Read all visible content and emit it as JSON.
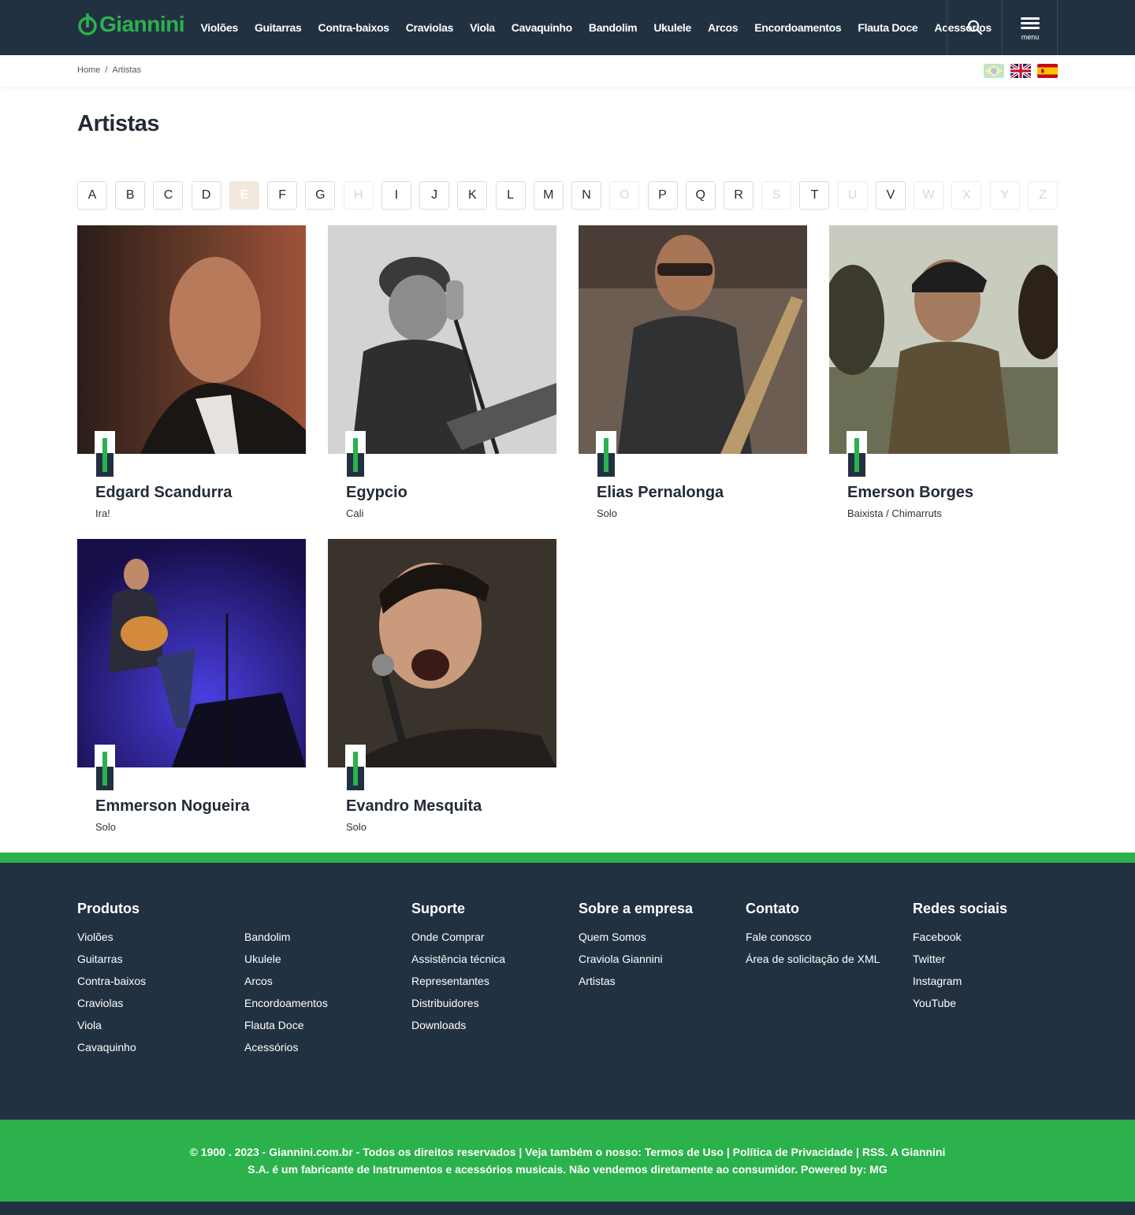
{
  "header": {
    "logo_text": "Giannini",
    "nav": [
      "Violões",
      "Guitarras",
      "Contra-baixos",
      "Craviolas",
      "Viola",
      "Cavaquinho",
      "Bandolim",
      "Ukulele",
      "Arcos",
      "Encordoamentos",
      "Flauta Doce",
      "Acessórios"
    ],
    "menu_label": "menu"
  },
  "breadcrumb": {
    "home": "Home",
    "separator": "/",
    "current": "Artistas"
  },
  "languages": [
    "pt-BR",
    "en",
    "es"
  ],
  "page_title": "Artistas",
  "alphabet": {
    "letters": [
      "A",
      "B",
      "C",
      "D",
      "E",
      "F",
      "G",
      "H",
      "I",
      "J",
      "K",
      "L",
      "M",
      "N",
      "O",
      "P",
      "Q",
      "R",
      "S",
      "T",
      "U",
      "V",
      "W",
      "X",
      "Y",
      "Z"
    ],
    "active": "E",
    "disabled": [
      "H",
      "O",
      "S",
      "U",
      "W",
      "X",
      "Y",
      "Z"
    ]
  },
  "artists": [
    {
      "name": "Edgard Scandurra",
      "band": "Ira!"
    },
    {
      "name": "Egypcio",
      "band": "Cali"
    },
    {
      "name": "Elias Pernalonga",
      "band": "Solo"
    },
    {
      "name": "Emerson Borges",
      "band": "Baixista / Chimarruts"
    },
    {
      "name": "Emmerson Nogueira",
      "band": "Solo"
    },
    {
      "name": "Evandro Mesquita",
      "band": "Solo"
    }
  ],
  "footer": {
    "produtos": {
      "title": "Produtos",
      "col1": [
        "Violões",
        "Guitarras",
        "Contra-baixos",
        "Craviolas",
        "Viola",
        "Cavaquinho"
      ],
      "col2": [
        "Bandolim",
        "Ukulele",
        "Arcos",
        "Encordoamentos",
        "Flauta Doce",
        "Acessórios"
      ]
    },
    "suporte": {
      "title": "Suporte",
      "links": [
        "Onde Comprar",
        "Assistência técnica",
        "Representantes",
        "Distribuidores",
        "Downloads"
      ]
    },
    "empresa": {
      "title": "Sobre a empresa",
      "links": [
        "Quem Somos",
        "Craviola Giannini",
        "Artistas"
      ]
    },
    "contato": {
      "title": "Contato",
      "links": [
        "Fale conosco",
        "Área de solicitação de XML"
      ]
    },
    "redes": {
      "title": "Redes sociais",
      "links": [
        "Facebook",
        "Twitter",
        "Instagram",
        "YouTube"
      ]
    },
    "copyright": "© 1900 . 2023 - Giannini.com.br - Todos os direitos reservados | Veja também o nosso: Termos de Uso | Política de Privacidade | RSS. A Giannini S.A. é um fabricante de Instrumentos e acessórios musicais. Não vendemos diretamente ao consumidor. Powered by: MG"
  },
  "colors": {
    "brand_green": "#2bb24c",
    "navy": "#223142",
    "active_letter": "#f3e8de"
  },
  "icons": {
    "search": "search-icon",
    "menu": "hamburger-icon"
  }
}
